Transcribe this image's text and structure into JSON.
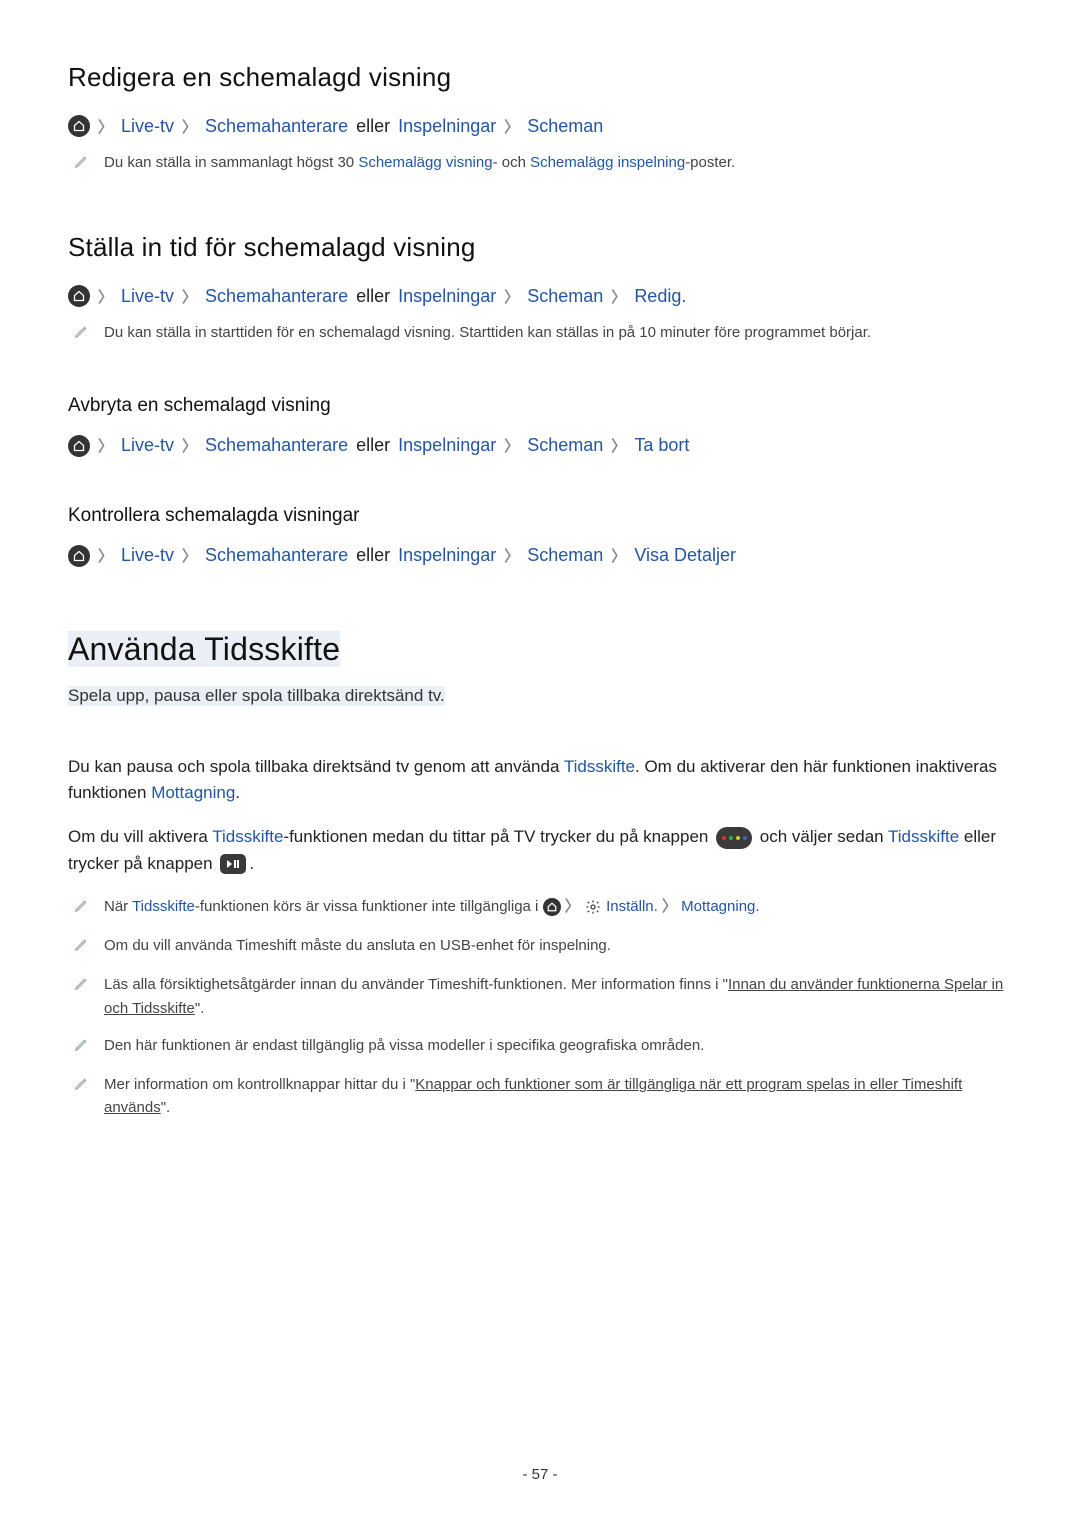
{
  "section1": {
    "heading": "Redigera en schemalagd visning",
    "path": {
      "live": "Live-tv",
      "mgr": "Schemahanterare",
      "or": "eller",
      "rec": "Inspelningar",
      "sched": "Scheman"
    },
    "note": {
      "pre": "Du kan ställa in sammanlagt högst 30 ",
      "link1": "Schemalägg visning",
      "mid": "- och ",
      "link2": "Schemalägg inspelning",
      "post": "-poster."
    }
  },
  "section2": {
    "heading": "Ställa in tid för schemalagd visning",
    "path": {
      "live": "Live-tv",
      "mgr": "Schemahanterare",
      "or": "eller",
      "rec": "Inspelningar",
      "sched": "Scheman",
      "edit": "Redig."
    },
    "note": "Du kan ställa in starttiden för en schemalagd visning. Starttiden kan ställas in på 10 minuter före programmet börjar."
  },
  "section3": {
    "heading": "Avbryta en schemalagd visning",
    "path": {
      "live": "Live-tv",
      "mgr": "Schemahanterare",
      "or": "eller",
      "rec": "Inspelningar",
      "sched": "Scheman",
      "del": "Ta bort"
    }
  },
  "section4": {
    "heading": "Kontrollera schemalagda visningar",
    "path": {
      "live": "Live-tv",
      "mgr": "Schemahanterare",
      "or": "eller",
      "rec": "Inspelningar",
      "sched": "Scheman",
      "details": "Visa Detaljer"
    }
  },
  "timeshift": {
    "heading": "Använda Tidsskifte",
    "subtitle": "Spela upp, pausa eller spola tillbaka direktsänd tv.",
    "p1": {
      "a": "Du kan pausa och spola tillbaka direktsänd tv genom att använda ",
      "ts": "Tidsskifte",
      "b": ". Om du aktiverar den här funktionen inaktiveras funktionen ",
      "rcv": "Mottagning",
      "c": "."
    },
    "p2": {
      "a": "Om du vill aktivera ",
      "ts": "Tidsskifte",
      "b": "-funktionen medan du tittar på TV trycker du på knappen ",
      "c": " och väljer sedan ",
      "ts2": "Tidsskifte",
      "d": " eller trycker på knappen ",
      "e": "."
    },
    "n1": {
      "a": "När ",
      "ts": "Tidsskifte",
      "b": "-funktionen körs är vissa funktioner inte tillgängliga i ",
      "settings": "Inställn.",
      "rcv": "Mottagning",
      "c": "."
    },
    "n2": "Om du vill använda Timeshift måste du ansluta en USB-enhet för inspelning.",
    "n3": {
      "a": "Läs alla försiktighetsåtgärder innan du använder Timeshift-funktionen. Mer information finns i \"",
      "link": "Innan du använder funktionerna Spelar in och Tidsskifte",
      "b": "\"."
    },
    "n4": "Den här funktionen är endast tillgänglig på vissa modeller i specifika geografiska områden.",
    "n5": {
      "a": "Mer information om kontrollknappar hittar du i \"",
      "link": "Knappar och funktioner som är tillgängliga när ett program spelas in eller Timeshift används",
      "b": "\"."
    }
  },
  "page": "- 57 -"
}
